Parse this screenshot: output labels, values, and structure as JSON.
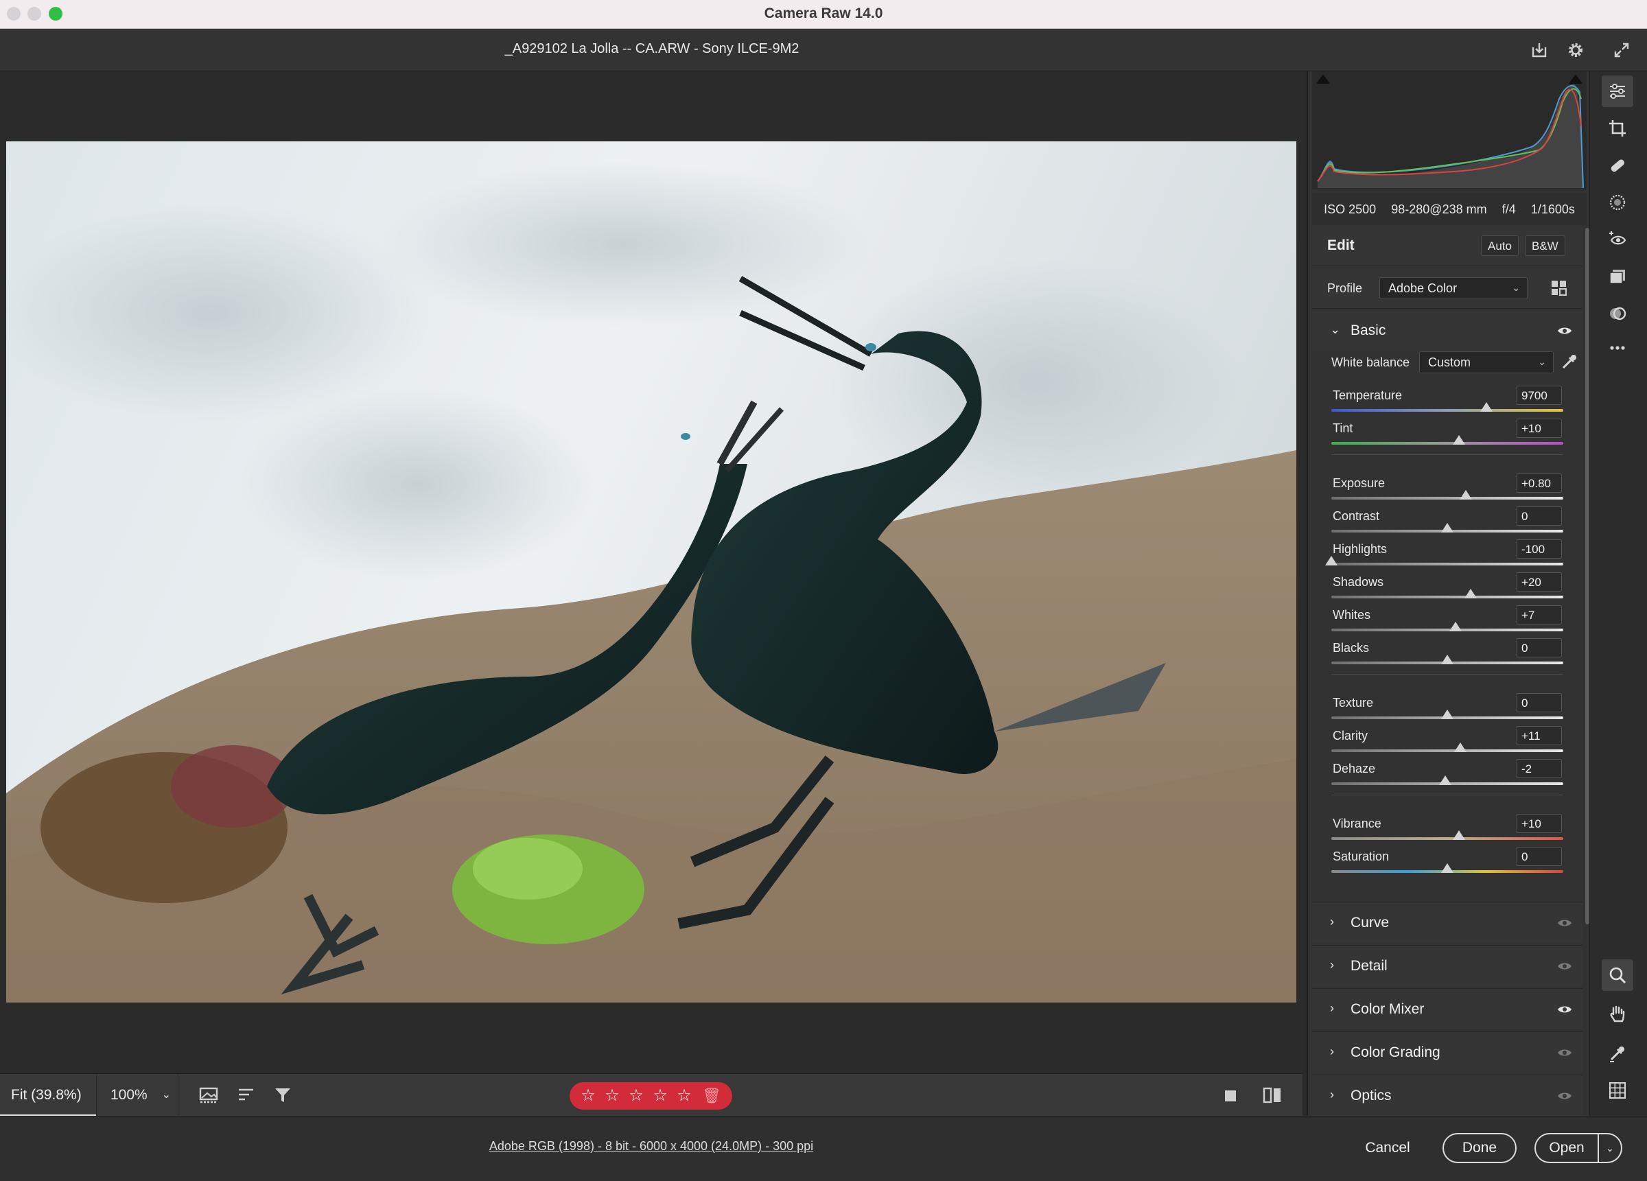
{
  "window": {
    "app_title": "Camera Raw 14.0"
  },
  "file": {
    "title": "_A929102  La Jolla -- CA.ARW  -  Sony ILCE-9M2"
  },
  "exif": {
    "iso": "ISO 2500",
    "lens": "98-280@238 mm",
    "aperture": "f/4",
    "shutter": "1/1600s"
  },
  "edit": {
    "title": "Edit",
    "auto_label": "Auto",
    "bw_label": "B&W"
  },
  "profile": {
    "label": "Profile",
    "value": "Adobe Color"
  },
  "basic": {
    "title": "Basic",
    "white_balance": {
      "label": "White balance",
      "value": "Custom"
    },
    "sliders": [
      {
        "label": "Temperature",
        "value": "9700",
        "pos": 0.67,
        "gradient": "temp"
      },
      {
        "label": "Tint",
        "value": "+10",
        "pos": 0.55,
        "gradient": "tint"
      },
      {
        "label": "Exposure",
        "value": "+0.80",
        "pos": 0.58,
        "gradient": "gray"
      },
      {
        "label": "Contrast",
        "value": "0",
        "pos": 0.5,
        "gradient": "gray"
      },
      {
        "label": "Highlights",
        "value": "-100",
        "pos": 0.0,
        "gradient": "gray"
      },
      {
        "label": "Shadows",
        "value": "+20",
        "pos": 0.6,
        "gradient": "gray"
      },
      {
        "label": "Whites",
        "value": "+7",
        "pos": 0.535,
        "gradient": "gray"
      },
      {
        "label": "Blacks",
        "value": "0",
        "pos": 0.5,
        "gradient": "gray"
      },
      {
        "label": "Texture",
        "value": "0",
        "pos": 0.5,
        "gradient": "gray"
      },
      {
        "label": "Clarity",
        "value": "+11",
        "pos": 0.555,
        "gradient": "gray"
      },
      {
        "label": "Dehaze",
        "value": "-2",
        "pos": 0.49,
        "gradient": "gray"
      },
      {
        "label": "Vibrance",
        "value": "+10",
        "pos": 0.55,
        "gradient": "vib"
      },
      {
        "label": "Saturation",
        "value": "0",
        "pos": 0.5,
        "gradient": "sat"
      }
    ]
  },
  "panels": [
    {
      "title": "Curve",
      "eye_active": false
    },
    {
      "title": "Detail",
      "eye_active": false
    },
    {
      "title": "Color Mixer",
      "eye_active": true
    },
    {
      "title": "Color Grading",
      "eye_active": false
    },
    {
      "title": "Optics",
      "eye_active": false
    }
  ],
  "toolbar": {
    "zoom_fit": "Fit (39.8%)",
    "zoom_100": "100%",
    "rating_stars": 5
  },
  "footer": {
    "workflow": "Adobe RGB (1998) - 8 bit - 6000 x 4000 (24.0MP) - 300 ppi",
    "cancel": "Cancel",
    "done": "Done",
    "open": "Open"
  },
  "colors": {
    "rating_bg": "#d22b3a",
    "accent_green": "#2fbf45"
  }
}
